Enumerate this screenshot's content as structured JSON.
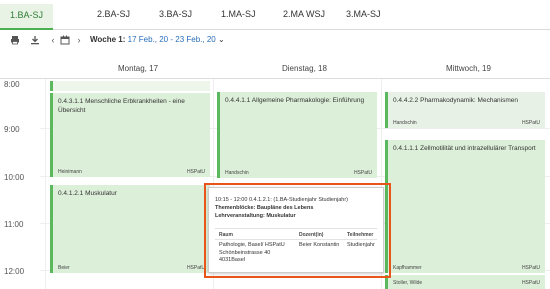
{
  "tabs": [
    {
      "label": "1.BA-SJ",
      "active": true
    },
    {
      "label": "2.BA-SJ",
      "active": false
    },
    {
      "label": "3.BA-SJ",
      "active": false
    },
    {
      "label": "1.MA-SJ",
      "active": false
    },
    {
      "label": "2.MA WSJ",
      "active": false
    },
    {
      "label": "3.MA-SJ",
      "active": false
    }
  ],
  "toolbar": {
    "print_icon": "printer-icon",
    "download_icon": "download-icon",
    "prev_icon": "chevron-left-icon",
    "calendar_icon": "calendar-icon",
    "next_icon": "chevron-right-icon",
    "week_label": "Woche 1:",
    "week_range": "17 Feb., 20 - 23 Feb., 20",
    "dropdown_icon": "chevron-down-icon"
  },
  "days": [
    "Montag, 17",
    "Dienstag, 18",
    "Mittwoch, 19"
  ],
  "times": [
    "8:00",
    "9:00",
    "10:00",
    "11:00",
    "12:00"
  ],
  "events": [
    {
      "title": "0.4.3.1.1 Menschliche Erbkrankheiten - eine Übersicht",
      "lecturer": "Heinimann",
      "location": "HSPatU"
    },
    {
      "title": "0.4.1.2.1 Muskulatur",
      "lecturer": "Beier",
      "location": "HSPatU"
    },
    {
      "title": "0.4.4.1.1 Allgemeine Pharmakologie: Einführung",
      "lecturer": "Handschin",
      "location": "HSPatU"
    },
    {
      "title": "0.4.4.2.2 Pharmakodynamik: Mechanismen",
      "lecturer": "Handschin",
      "location": "HSPatU"
    },
    {
      "title": "0.4.1.1.1 Zellmotilität und intrazellulärer Transport",
      "lecturer": "Kapfhammer",
      "location": "HSPatU"
    },
    {
      "title": "",
      "lecturer": "Stoller, Wilde",
      "location": "HSPatU"
    }
  ],
  "popup": {
    "line1": "10:15 - 12:00 0.4.1.2.1: (1.BA-Studienjahr Studienjahr)",
    "line2": "Themenblöcke: Baupläne des Lebens",
    "line3": "Lehrveranstaltung: Muskulatur",
    "headers": [
      "Raum",
      "Dozent(in)",
      "Teilnehmer"
    ],
    "raum": [
      "Pathologie, Basel/ HSPatU",
      "Schönbeinstrasse 40",
      "4031Basel"
    ],
    "dozent": "Beier Konstantin",
    "teilnehmer": "Studienjahr"
  },
  "colors": {
    "accent": "#5cb85c",
    "event_bg": "#dcefd9",
    "highlight": "#e8541a",
    "link": "#2a6ebb"
  }
}
